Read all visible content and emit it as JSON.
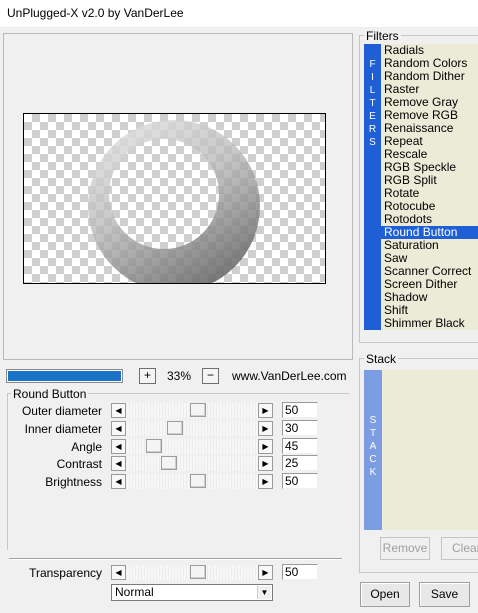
{
  "window": {
    "title": "UnPlugged-X v2.0 by VanDerLee"
  },
  "toolbar": {
    "progress": 1.0,
    "zoom_in": "+",
    "zoom_out": "−",
    "zoom_value": "33%",
    "website": "www.VanDerLee.com"
  },
  "params": {
    "group_title": "Round Button",
    "rows": [
      {
        "label": "Outer diameter",
        "value": "50",
        "level": 0.5
      },
      {
        "label": "Inner diameter",
        "value": "30",
        "level": 0.3
      },
      {
        "label": "Angle",
        "value": "45",
        "level": 0.125
      },
      {
        "label": "Contrast",
        "value": "25",
        "level": 0.25
      },
      {
        "label": "Brightness",
        "value": "50",
        "level": 0.5
      }
    ],
    "transparency": {
      "label": "Transparency",
      "value": "50",
      "level": 0.5
    },
    "blend_mode": "Normal"
  },
  "filters": {
    "title": "Filters",
    "side_letters": [
      "F",
      "I",
      "L",
      "T",
      "E",
      "R",
      "S"
    ],
    "items": [
      "Radials",
      "Random Colors",
      "Random Dither",
      "Raster",
      "Remove Gray",
      "Remove RGB",
      "Renaissance",
      "Repeat",
      "Rescale",
      "RGB Speckle",
      "RGB Split",
      "Rotate",
      "Rotocube",
      "Rotodots",
      "Round Button",
      "Saturation",
      "Saw",
      "Scanner Correct",
      "Screen Dither",
      "Shadow",
      "Shift",
      "Shimmer Black"
    ],
    "selected": "Round Button"
  },
  "stack": {
    "title": "Stack",
    "side_letters": [
      "S",
      "T",
      "A",
      "C",
      "K"
    ],
    "remove": "Remove",
    "clear": "Clear"
  },
  "buttons": {
    "open": "Open",
    "save": "Save"
  },
  "colors": {
    "accent": "#1e5fd6",
    "stack_bar": "#7d9de2",
    "list_bg": "#ecebd8"
  }
}
